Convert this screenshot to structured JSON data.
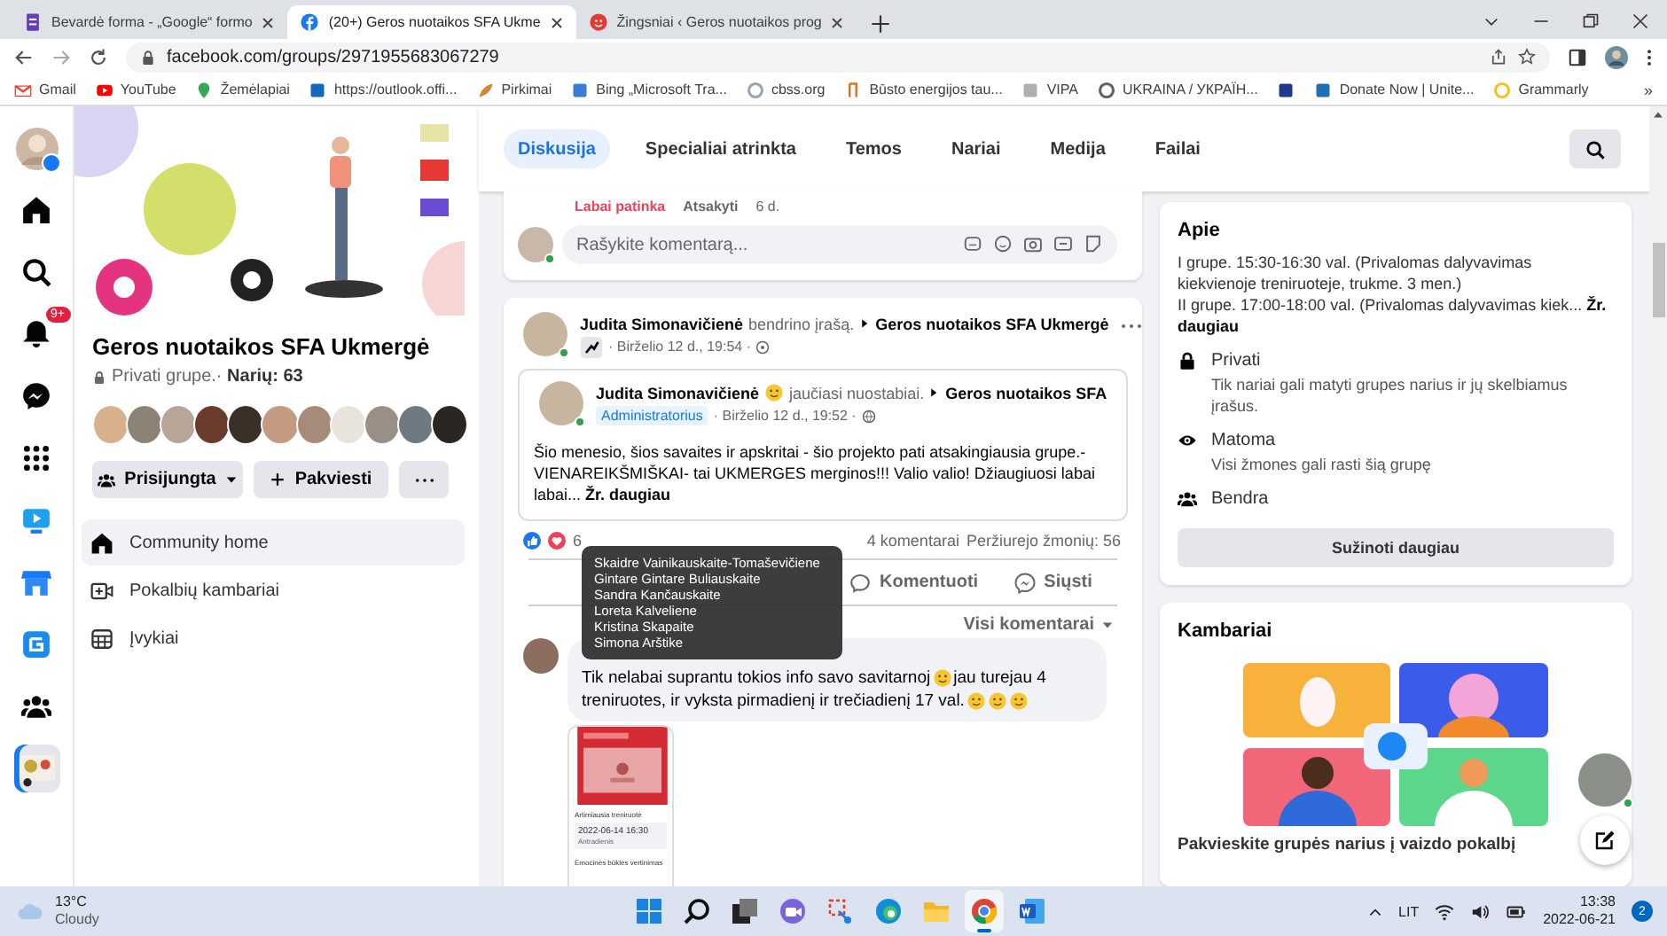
{
  "browser": {
    "tabs": [
      {
        "title": "Bevardė forma - „Google“ formo",
        "kind": "forms",
        "selected": false
      },
      {
        "title": "(20+) Geros nuotaikos SFA Ukme",
        "kind": "facebook",
        "selected": true
      },
      {
        "title": "Žingsniai ‹ Geros nuotaikos prog",
        "kind": "red",
        "selected": false
      }
    ],
    "address": "facebook.com/groups/2971955683067279",
    "bookmarks": [
      {
        "label": "Gmail",
        "kind": "gmail"
      },
      {
        "label": "YouTube",
        "kind": "youtube"
      },
      {
        "label": "Žemėlapiai",
        "kind": "maps"
      },
      {
        "label": "https://outlook.offi...",
        "kind": "outlook"
      },
      {
        "label": "Pirkimai",
        "kind": "pirkimai"
      },
      {
        "label": "Bing „Microsoft Tra...",
        "kind": "bing"
      },
      {
        "label": "cbss.org",
        "kind": "cbss"
      },
      {
        "label": "Būsto energijos tau...",
        "kind": "busto"
      },
      {
        "label": "VIPA",
        "kind": "vipa"
      },
      {
        "label": "UKRAINA / УКРАЇН...",
        "kind": "globe"
      },
      {
        "kind": "flag"
      },
      {
        "label": "Donate Now | Unite...",
        "kind": "donate"
      },
      {
        "label": "Grammarly",
        "kind": "grammarly"
      }
    ],
    "bookmarks_more": "»"
  },
  "rail": [
    {
      "kind": "profile",
      "selected": false
    },
    {
      "kind": "home",
      "selected": false
    },
    {
      "kind": "search",
      "selected": false
    },
    {
      "kind": "notifications",
      "badge": "9+",
      "selected": false
    },
    {
      "kind": "messenger",
      "selected": false
    },
    {
      "kind": "apps",
      "selected": false
    },
    {
      "kind": "watch",
      "selected": false
    },
    {
      "kind": "marketplace",
      "selected": false
    },
    {
      "kind": "gaming",
      "selected": false
    },
    {
      "kind": "groups",
      "selected": false
    },
    {
      "kind": "group",
      "selected": true
    }
  ],
  "group": {
    "title": "Geros nuotaikos SFA Ukmergė",
    "privacy": "Privati grupe.· **Narių: 63**",
    "buttons": [
      {
        "kind": "joined",
        "label": "Prisijungta"
      },
      {
        "kind": "invite",
        "label": "Pakviesti"
      },
      {
        "kind": "more"
      }
    ],
    "nav": [
      {
        "kind": "home",
        "label": "Community home",
        "selected": true
      },
      {
        "kind": "rooms",
        "label": "Pokalbių kambariai",
        "selected": false
      },
      {
        "kind": "events",
        "label": "Įvykiai",
        "selected": false
      }
    ]
  },
  "tabs": [
    {
      "label": "Diskusija",
      "selected": true
    },
    {
      "label": "Specialiai atrinkta",
      "selected": false
    },
    {
      "label": "Temos",
      "selected": false
    },
    {
      "label": "Nariai",
      "selected": false
    },
    {
      "label": "Medija",
      "selected": false
    },
    {
      "label": "Failai",
      "selected": false
    }
  ],
  "previous_post": {
    "reaction": "Labai patinka",
    "reply": "Atsakyti",
    "age": "6 d.",
    "comment_placeholder": "Rašykite komentarą..."
  },
  "post": {
    "author": "Judita Simonavičienė",
    "action": "bendrino įrašą.",
    "group": "Geros nuotaikos SFA Ukmergė",
    "time": "· Birželio 12 d., 19:54 ·",
    "shared": {
      "author": "Judita Simonavičienė",
      "feeling": "jaučiasi nuostabiai.",
      "group": "Geros nuotaikos SFA",
      "role": "Administratorius",
      "time": "· Birželio 12 d., 19:52 ·",
      "text": "Šio menesio, šios savaites ir apskritai - šio projekto pati atsakingiausia grupe.- VIENAREIKŠMIŠKAI- tai UKMERGES merginos!!! Valio valio! Džiaugiuosi labai labai... **Žr. daugiau**"
    },
    "reaction_count": "6",
    "comments": "4 komentarai",
    "views": "Peržiurejo žmonių: 56",
    "actions": [
      {
        "kind": "comment",
        "label": "Komentuoti"
      },
      {
        "kind": "send",
        "label": "Siųsti"
      }
    ],
    "tooltip": [
      "Skaidre Vainikauskaite-Tomaševičiene",
      "Gintare Gintare Buliauskaite",
      "Sandra Kančauskaite",
      "Loreta Kalveliene",
      "Kristina Skapaite",
      "Simona Arštike"
    ],
    "comment_filter": "Visi komentarai",
    "comment": {
      "text_1": "Tik nelabai suprantu tokios info savo savitarnoj",
      "text_2": "jau turejau 4",
      "text_3": "treniruotes, ir vyksta pirmadienį ir trečiadienį 17 val.",
      "attachment": {
        "heading": "Artimiausia treniruotė",
        "date": "2022-06-14 16:30",
        "day": "Antradienis",
        "footer": "Emocinės būklės vertinimas"
      }
    }
  },
  "about": {
    "title": "Apie",
    "paragraphs": [
      "I grupe. 15:30-16:30 val. (Privalomas dalyvavimas kiekvienoje treniruoteje, trukme. 3 men.)",
      "II grupe. 17:00-18:00 val. (Privalomas dalyvavimas kiek... **Žr. daugiau**"
    ],
    "items": [
      {
        "kind": "lock",
        "title": "Privati",
        "text": "Tik nariai gali matyti grupes narius ir jų skelbiamus įrašus."
      },
      {
        "kind": "eye",
        "title": "Matoma",
        "text": "Visi žmones gali rasti šią grupę"
      },
      {
        "kind": "people",
        "title": "Bendra"
      }
    ],
    "button": "Sužinoti daugiau"
  },
  "rooms": {
    "title": "Kambariai",
    "caption": "Pakvieskite grupės narius į vaizdo pokalbį"
  },
  "taskbar": {
    "temperature": "13°C",
    "weather": "Cloudy",
    "apps": [
      {
        "kind": "start",
        "selected": false
      },
      {
        "kind": "search",
        "selected": false
      },
      {
        "kind": "taskview",
        "selected": false
      },
      {
        "kind": "chat",
        "selected": false
      },
      {
        "kind": "snip",
        "selected": false
      },
      {
        "kind": "edge",
        "selected": false
      },
      {
        "kind": "explorer",
        "selected": false
      },
      {
        "kind": "chrome",
        "selected": true
      },
      {
        "kind": "word",
        "selected": false
      }
    ],
    "language": "LIT",
    "time": "13:38",
    "date": "2022-06-21",
    "notifications": "2"
  }
}
